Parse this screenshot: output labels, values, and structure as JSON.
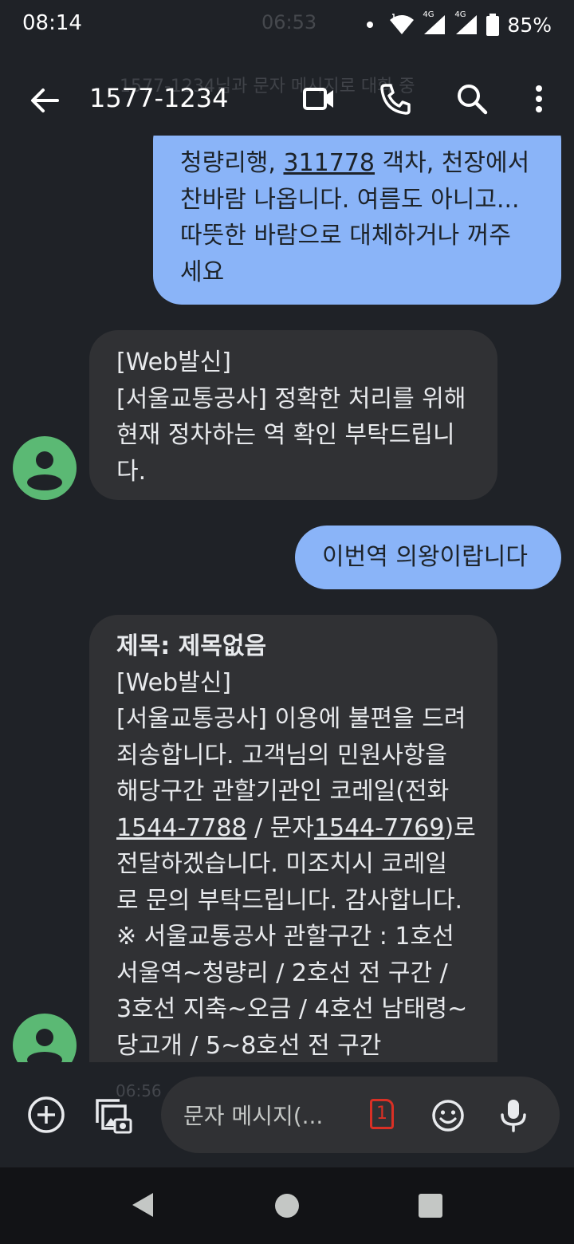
{
  "status_bar": {
    "time": "08:14",
    "ghost_time": "06:53",
    "battery": "85%",
    "network_1": "4G",
    "network_2": "4G"
  },
  "app_bar": {
    "title": "1577-1234",
    "ghost_banner": "1577-1234님과 문자 메시지로 대화 중",
    "icons": [
      "back-arrow-icon",
      "video-call-icon",
      "phone-icon",
      "search-icon",
      "more-vert-icon"
    ]
  },
  "messages": [
    {
      "direction": "outgoing",
      "lines": [
        [
          "청량리행, ",
          {
            "link": "311778"
          },
          " 객차, 천장에서"
        ],
        [
          "찬바람 나옵니다. 여름도 아니고..."
        ],
        [
          "따뜻한 바람으로 대체하거나 꺼주"
        ],
        [
          "세요"
        ]
      ]
    },
    {
      "direction": "incoming",
      "lines": [
        [
          "[Web발신]"
        ],
        [
          "[서울교통공사] 정확한 처리를 위해"
        ],
        [
          "현재 정차하는 역 확인 부탁드립니"
        ],
        [
          "다."
        ]
      ]
    },
    {
      "direction": "outgoing",
      "lines": [
        [
          "이번역 의왕이랍니다"
        ]
      ]
    },
    {
      "direction": "incoming",
      "subject": "제목: 제목없음",
      "lines": [
        [
          "[Web발신]"
        ],
        [
          "[서울교통공사] 이용에 불편을 드려"
        ],
        [
          "죄송합니다. 고객님의 민원사항을"
        ],
        [
          "해당구간 관할기관인 코레일(전화"
        ],
        [
          {
            "link": "1544-7788"
          },
          " / 문자",
          {
            "link": "1544-7769"
          },
          ")로"
        ],
        [
          "전달하겠습니다. 미조치시 코레일"
        ],
        [
          "로 문의 부탁드립니다. 감사합니다."
        ],
        [
          "※ 서울교통공사 관할구간 : 1호선"
        ],
        [
          "서울역~청량리 / 2호선 전 구간 /"
        ],
        [
          "3호선 지축~오금 / 4호선 남태령~"
        ],
        [
          "당고개 / 5~8호선 전 구간"
        ]
      ]
    }
  ],
  "composer": {
    "placeholder": "문자 메시지(...",
    "sim_badge": "1",
    "ghost_time": "06:56",
    "icons": [
      "add-icon",
      "gallery-icon",
      "emoji-icon",
      "mic-icon"
    ]
  },
  "colors": {
    "background": "#1f2227",
    "outgoing_bubble": "#8ab4f8",
    "incoming_bubble": "#303134",
    "avatar": "#5bb974",
    "sim_badge": "#d93025"
  }
}
